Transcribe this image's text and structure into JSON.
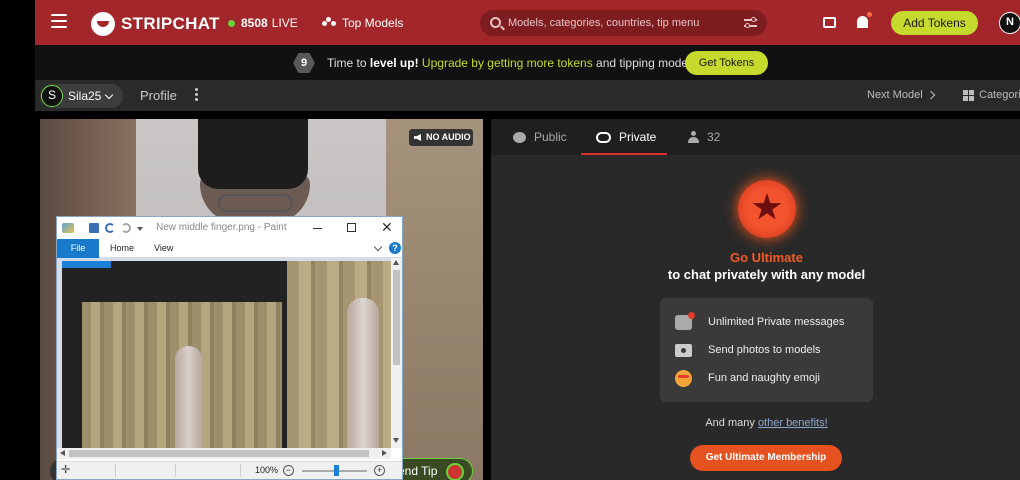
{
  "header": {
    "logo_text": "STRIPCHAT",
    "live_count": "8508",
    "live_label": "LIVE",
    "top_models": "Top Models",
    "search_placeholder": "Models, categories, countries, tip menu",
    "add_tokens": "Add Tokens",
    "user_initial": "N"
  },
  "promo": {
    "level": "9",
    "text_before": "Time to ",
    "text_bold": "level up!",
    "text_green": " Upgrade by getting more tokens",
    "text_after": " and tipping models.",
    "button": "Get Tokens"
  },
  "model_bar": {
    "model_initial": "S",
    "model_name": "Sila25",
    "profile": "Profile",
    "next_model": "Next Model",
    "categories": "Categori"
  },
  "video": {
    "no_audio": "NO AUDIO",
    "send_tip": "end Tip"
  },
  "paint": {
    "title": "New middle finger.png - Paint",
    "close": "✕",
    "tabs": {
      "file": "File",
      "home": "Home",
      "view": "View"
    },
    "help": "?",
    "cursor": "✛",
    "zoom": "100%",
    "zoom_minus": "−",
    "zoom_plus": "+"
  },
  "panel": {
    "tabs": {
      "public": "Public",
      "private": "Private",
      "users": "32"
    },
    "go_ultimate": "Go Ultimate",
    "subtitle": "to chat privately with any model",
    "benefits": [
      {
        "label": "Unlimited Private messages",
        "icon": "message-icon"
      },
      {
        "label": "Send photos to models",
        "icon": "camera-icon"
      },
      {
        "label": "Fun and naughty emoji",
        "icon": "emoji-icon"
      }
    ],
    "many_prefix": "And many ",
    "many_link": "other benefits!",
    "cta": "Get Ultimate Membership"
  },
  "colors": {
    "brand_red": "#a3262a",
    "accent_green": "#c6d92d",
    "ultimate_orange": "#e5511f"
  }
}
